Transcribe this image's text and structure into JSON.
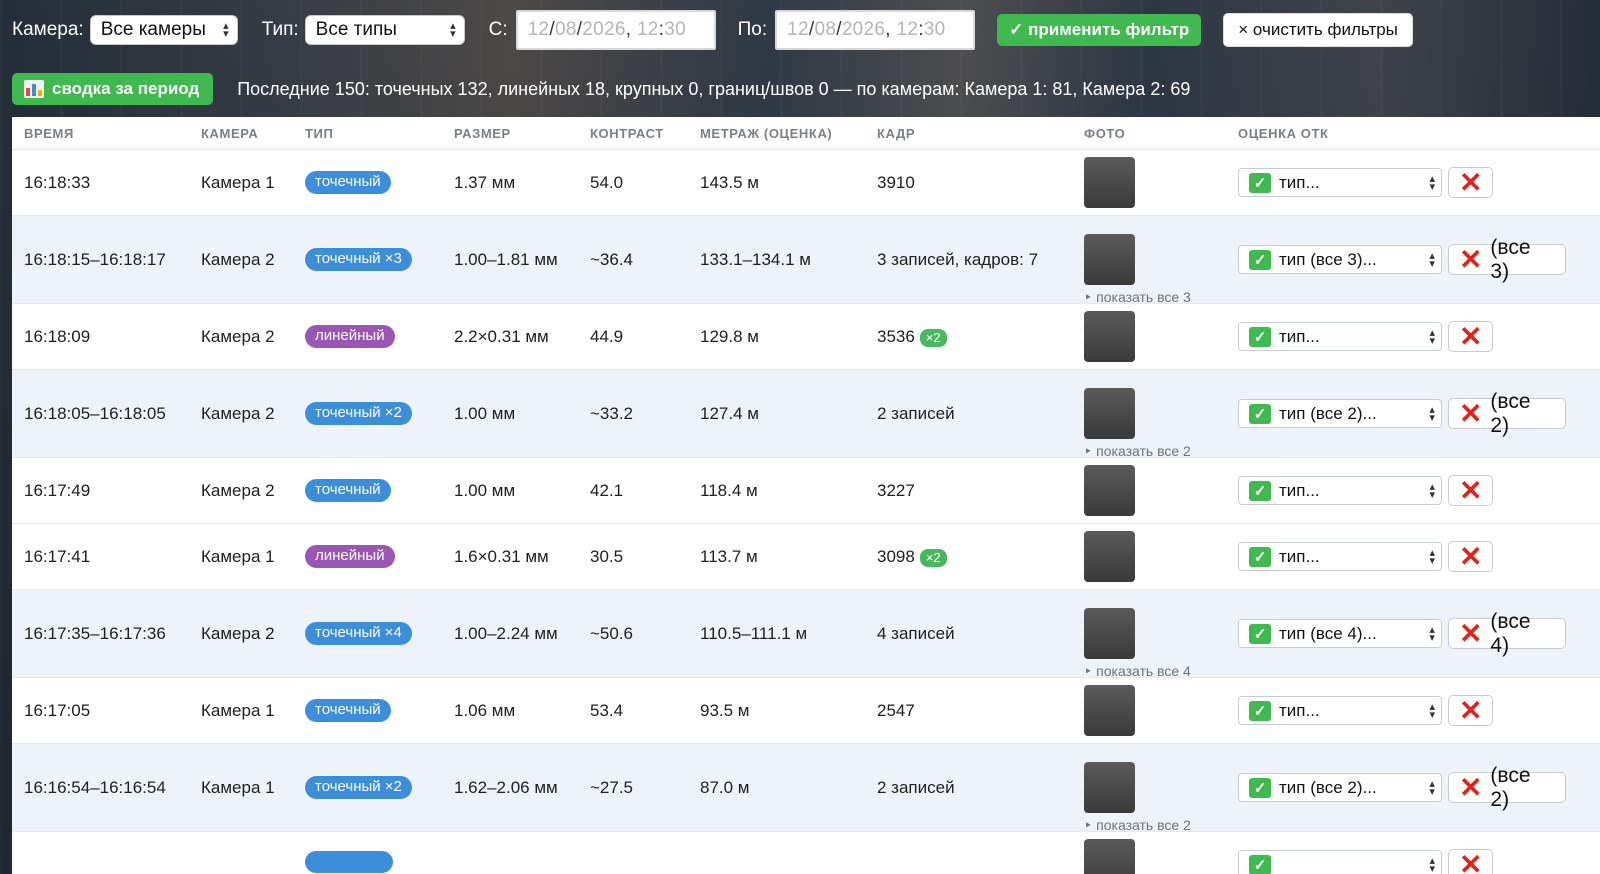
{
  "filters": {
    "camera_label": "Камера:",
    "camera_value": "Все камеры",
    "type_label": "Тип:",
    "type_value": "Все типы",
    "from_label": "С:",
    "from_value": {
      "d": "12",
      "m": "08",
      "y": "2026",
      "h": "12",
      "min": "30"
    },
    "to_label": "По:",
    "to_value": {
      "d": "12",
      "m": "08",
      "y": "2026",
      "h": "12",
      "min": "30"
    },
    "apply_label": "✓ применить фильтр",
    "clear_label": "× очистить фильтры"
  },
  "summary": {
    "button_label": "сводка за период",
    "text": "Последние 150: точечных 132, линейных 18, крупных 0, границ/швов 0 — по камерам: Камера 1: 81, Камера 2: 69"
  },
  "table": {
    "headers": [
      "ВРЕМЯ",
      "КАМЕРА",
      "ТИП",
      "РАЗМЕР",
      "КОНТРАСТ",
      "МЕТРАЖ (ОЦЕНКА)",
      "КАДР",
      "ФОТО",
      "ОЦЕНКА ОТК"
    ],
    "rows": [
      {
        "time": "16:18:33",
        "camera": "Камера 1",
        "type": "точечный",
        "type_kind": "point",
        "size": "1.37 мм",
        "contrast": "54.0",
        "length": "143.5 м",
        "frame": "3910",
        "frame_badge": "",
        "show_all": "",
        "otk": "тип...",
        "x_label": ""
      },
      {
        "time": "16:18:15–16:18:17",
        "camera": "Камера 2",
        "type": "точечный ×3",
        "type_kind": "point",
        "size": "1.00–1.81 мм",
        "contrast": "~36.4",
        "length": "133.1–134.1 м",
        "frame": "3 записей, кадров: 7",
        "frame_badge": "",
        "show_all": "‣ показать все 3",
        "otk": "тип (все 3)...",
        "x_label": "(все 3)"
      },
      {
        "time": "16:18:09",
        "camera": "Камера 2",
        "type": "линейный",
        "type_kind": "line",
        "size": "2.2×0.31 мм",
        "contrast": "44.9",
        "length": "129.8 м",
        "frame": "3536",
        "frame_badge": "×2",
        "show_all": "",
        "otk": "тип...",
        "x_label": ""
      },
      {
        "time": "16:18:05–16:18:05",
        "camera": "Камера 2",
        "type": "точечный ×2",
        "type_kind": "point",
        "size": "1.00 мм",
        "contrast": "~33.2",
        "length": "127.4 м",
        "frame": "2 записей",
        "frame_badge": "",
        "show_all": "‣ показать все 2",
        "otk": "тип (все 2)...",
        "x_label": "(все 2)"
      },
      {
        "time": "16:17:49",
        "camera": "Камера 2",
        "type": "точечный",
        "type_kind": "point",
        "size": "1.00 мм",
        "contrast": "42.1",
        "length": "118.4 м",
        "frame": "3227",
        "frame_badge": "",
        "show_all": "",
        "otk": "тип...",
        "x_label": ""
      },
      {
        "time": "16:17:41",
        "camera": "Камера 1",
        "type": "линейный",
        "type_kind": "line",
        "size": "1.6×0.31 мм",
        "contrast": "30.5",
        "length": "113.7 м",
        "frame": "3098",
        "frame_badge": "×2",
        "show_all": "",
        "otk": "тип...",
        "x_label": ""
      },
      {
        "time": "16:17:35–16:17:36",
        "camera": "Камера 2",
        "type": "точечный ×4",
        "type_kind": "point",
        "size": "1.00–2.24 мм",
        "contrast": "~50.6",
        "length": "110.5–111.1 м",
        "frame": "4 записей",
        "frame_badge": "",
        "show_all": "‣ показать все 4",
        "otk": "тип (все 4)...",
        "x_label": "(все 4)"
      },
      {
        "time": "16:17:05",
        "camera": "Камера 1",
        "type": "точечный",
        "type_kind": "point",
        "size": "1.06 мм",
        "contrast": "53.4",
        "length": "93.5 м",
        "frame": "2547",
        "frame_badge": "",
        "show_all": "",
        "otk": "тип...",
        "x_label": ""
      },
      {
        "time": "16:16:54–16:16:54",
        "camera": "Камера 1",
        "type": "точечный ×2",
        "type_kind": "point",
        "size": "1.62–2.06 мм",
        "contrast": "~27.5",
        "length": "87.0 м",
        "frame": "2 записей",
        "frame_badge": "",
        "show_all": "‣ показать все 2",
        "otk": "тип (все 2)...",
        "x_label": "(все 2)"
      },
      {
        "time": "",
        "camera": "",
        "type": "",
        "type_kind": "point",
        "size": "",
        "contrast": "",
        "length": "",
        "frame": "",
        "frame_badge": "",
        "show_all": "",
        "otk": "",
        "x_label": ""
      }
    ]
  },
  "icons": {
    "check": "✅",
    "cross": "❌",
    "chart": "chart-icon"
  },
  "colors": {
    "accent_green": "#3fb950",
    "badge_point": "#3d8ed8",
    "badge_line": "#9a56b5",
    "cross_red": "#e2231a"
  }
}
